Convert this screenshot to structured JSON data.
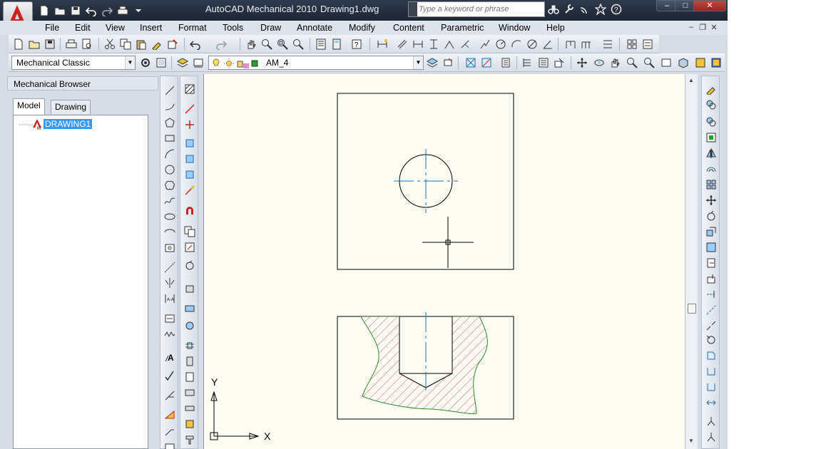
{
  "title": {
    "app_name": "AutoCAD Mechanical 2010",
    "document": "Drawing1.dwg",
    "search_placeholder": "Type a keyword or phrase"
  },
  "menu": [
    "File",
    "Edit",
    "View",
    "Insert",
    "Format",
    "Tools",
    "Draw",
    "Annotate",
    "Modify",
    "Content",
    "Parametric",
    "Window",
    "Help"
  ],
  "toolbar": {
    "workspace": "Mechanical Classic",
    "layer": "AM_4"
  },
  "browser": {
    "title": "Mechanical Browser",
    "tabs": [
      "Model",
      "Drawing"
    ],
    "active_tab": "Model",
    "tree_root": "DRAWING1"
  },
  "canvas": {
    "ucs_y": "Y",
    "ucs_x": "X"
  },
  "colors": {
    "accent_red": "#cc2222",
    "center_line": "#1a6fb0",
    "hatch": "#c03030",
    "hatch_boundary": "#2a8a2a",
    "layer_swatch": "#1fa32a"
  }
}
